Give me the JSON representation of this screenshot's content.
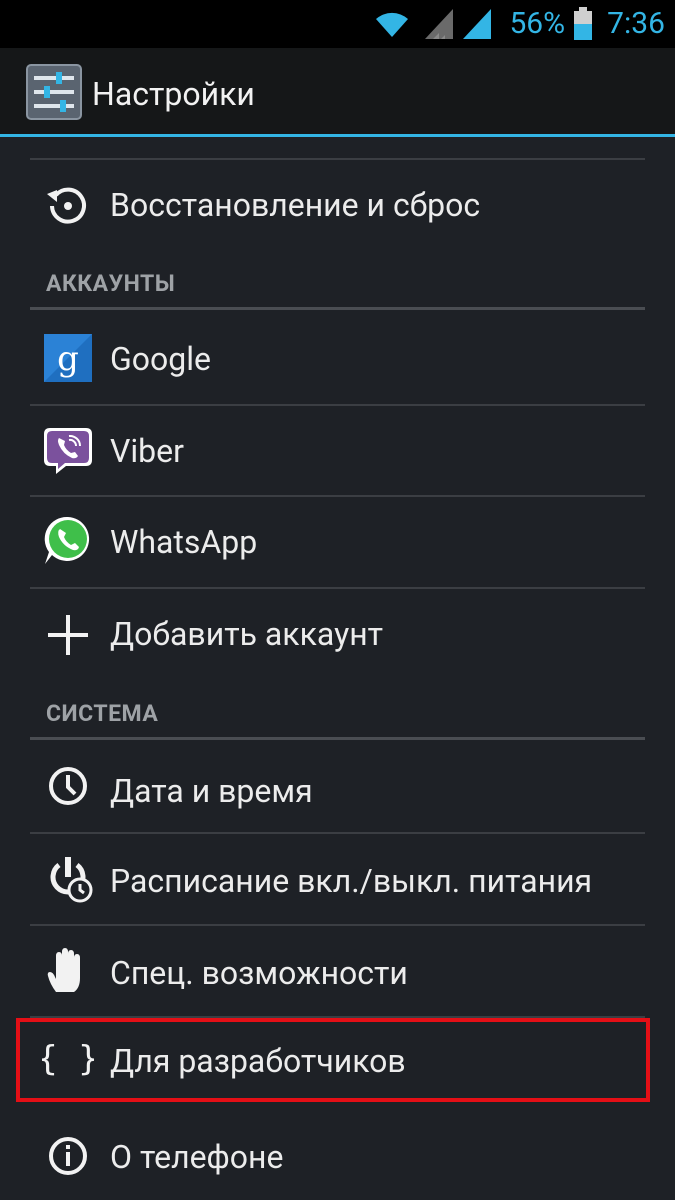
{
  "status_bar": {
    "battery_percent": "56%",
    "time": "7:36",
    "accent_color": "#33b5e5"
  },
  "action_bar": {
    "title": "Настройки",
    "icon": "settings-sliders-icon"
  },
  "list": {
    "items": [
      {
        "label": "Восстановление и сброс",
        "icon": "restore-icon"
      },
      {
        "label": "Google",
        "icon": "google-icon"
      },
      {
        "label": "Viber",
        "icon": "viber-icon"
      },
      {
        "label": "WhatsApp",
        "icon": "whatsapp-icon"
      },
      {
        "label": "Добавить аккаунт",
        "icon": "plus-icon"
      },
      {
        "label": "Дата и время",
        "icon": "clock-icon"
      },
      {
        "label": "Расписание вкл./выкл. питания",
        "icon": "power-schedule-icon"
      },
      {
        "label": "Спец. возможности",
        "icon": "hand-icon"
      },
      {
        "label": "Для разработчиков",
        "icon": "braces-icon"
      },
      {
        "label": "О телефоне",
        "icon": "info-icon"
      }
    ],
    "sections": {
      "accounts": "АККАУНТЫ",
      "system": "СИСТЕМА"
    }
  },
  "highlight_color": "#e40f16"
}
